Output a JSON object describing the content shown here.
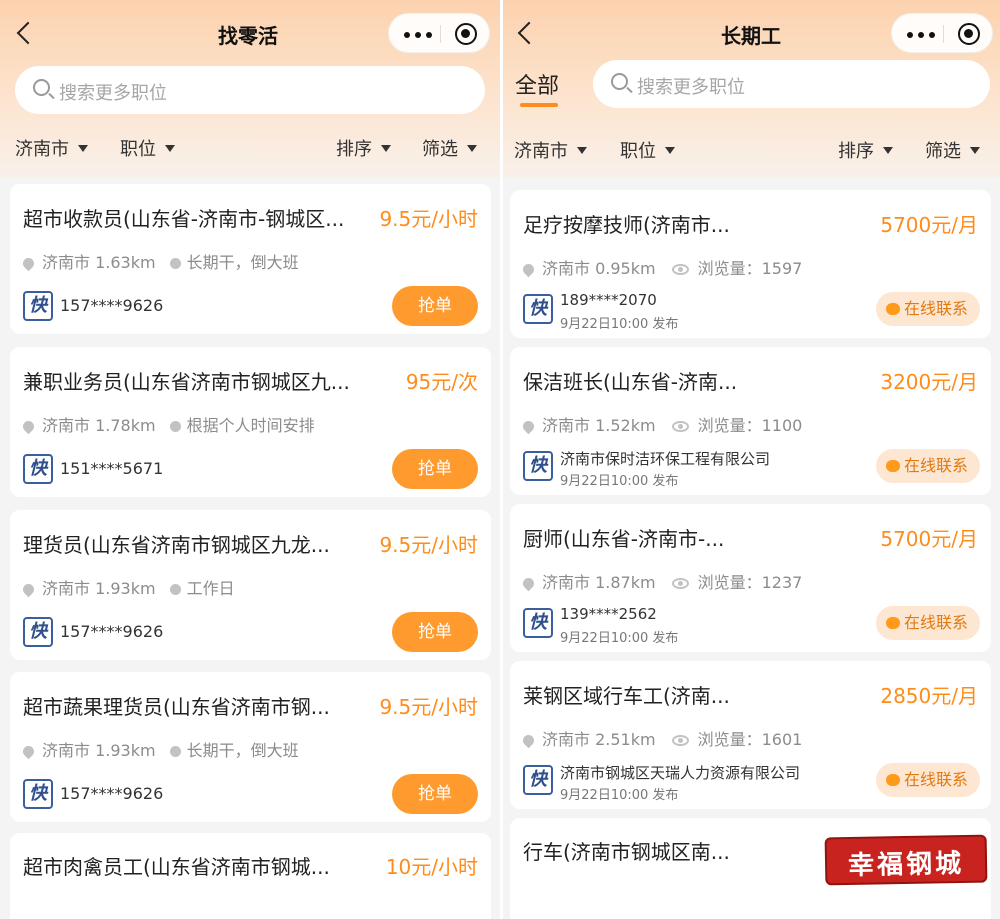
{
  "left": {
    "title": "找零活",
    "search_placeholder": "搜索更多职位",
    "filters": {
      "city": "济南市",
      "position": "职位",
      "sort": "排序",
      "screen": "筛选"
    },
    "action_label": "抢单",
    "logo_char": "快",
    "jobs": [
      {
        "title": "超市收款员(山东省-济南市-钢城区...",
        "pay": "9.5元/小时",
        "location": "济南市 1.63km",
        "schedule": "长期干，倒大班",
        "phone": "157****9626"
      },
      {
        "title": "兼职业务员(山东省济南市钢城区九...",
        "pay": "95元/次",
        "location": "济南市 1.78km",
        "schedule": "根据个人时间安排",
        "phone": "151****5671"
      },
      {
        "title": "理货员(山东省济南市钢城区九龙...",
        "pay": "9.5元/小时",
        "location": "济南市 1.93km",
        "schedule": "工作日",
        "phone": "157****9626"
      },
      {
        "title": "超市蔬果理货员(山东省济南市钢...",
        "pay": "9.5元/小时",
        "location": "济南市 1.93km",
        "schedule": "长期干，倒大班",
        "phone": "157****9626"
      },
      {
        "title": "超市肉禽员工(山东省济南市钢城...",
        "pay": "10元/小时"
      }
    ]
  },
  "right": {
    "title": "长期工",
    "tab": "全部",
    "search_placeholder": "搜索更多职位",
    "filters": {
      "city": "济南市",
      "position": "职位",
      "sort": "排序",
      "screen": "筛选"
    },
    "contact_label": "在线联系",
    "logo_char": "快",
    "jobs": [
      {
        "title": "足疗按摩技师(济南市...",
        "pay": "5700元/月",
        "location": "济南市 0.95km",
        "views": "浏览量：1597",
        "publisher": "189****2070",
        "date": "9月22日10:00 发布"
      },
      {
        "title": "保洁班长(山东省-济南...",
        "pay": "3200元/月",
        "location": "济南市 1.52km",
        "views": "浏览量：1100",
        "publisher": "济南市保时洁环保工程有限公司",
        "date": "9月22日10:00 发布"
      },
      {
        "title": "厨师(山东省-济南市-...",
        "pay": "5700元/月",
        "location": "济南市 1.87km",
        "views": "浏览量：1237",
        "publisher": "139****2562",
        "date": "9月22日10:00 发布"
      },
      {
        "title": "莱钢区域行车工(济南...",
        "pay": "2850元/月",
        "location": "济南市 2.51km",
        "views": "浏览量：1601",
        "publisher": "济南市钢城区天瑞人力资源有限公司",
        "date": "9月22日10:00 发布"
      },
      {
        "title": "行车(济南市钢城区南..."
      }
    ]
  },
  "watermark": "幸福钢城",
  "colors": {
    "accent": "#ff9a2e",
    "pay": "#ff8c1a",
    "header": "#fcd2ae"
  }
}
